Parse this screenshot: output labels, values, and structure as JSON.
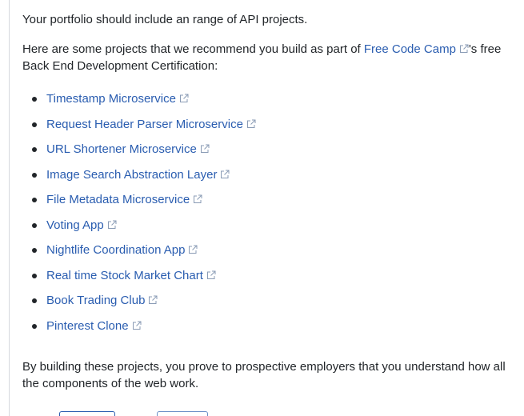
{
  "intro_text": "Your portfolio should include an range of API projects.",
  "recommend": {
    "prefix": "Here are some projects that we recommend you build as part of ",
    "link_label": "Free Code Camp",
    "suffix": "'s free Back End Development Certification:"
  },
  "projects": [
    {
      "label": "Timestamp Microservice"
    },
    {
      "label": "Request Header Parser Microservice"
    },
    {
      "label": "URL Shortener Microservice"
    },
    {
      "label": "Image Search Abstraction Layer"
    },
    {
      "label": "File Metadata Microservice"
    },
    {
      "label": "Voting App"
    },
    {
      "label": "Nightlife Coordination App"
    },
    {
      "label": "Real time Stock Market Chart"
    },
    {
      "label": "Book Trading Club"
    },
    {
      "label": "Pinterest Clone"
    }
  ],
  "closing_text": "By building these projects, you prove to prospective employers that you understand how all the components of the web work.",
  "colors": {
    "link": "#2a5db0",
    "text": "#212529"
  },
  "icons": {
    "external_link": "external-link-icon"
  }
}
